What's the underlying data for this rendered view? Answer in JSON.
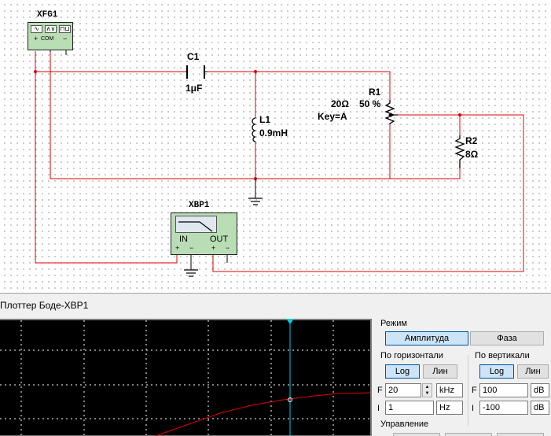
{
  "schematic": {
    "xfg": {
      "label": "XFG1",
      "com": "COM",
      "plus": "+",
      "minus": "−",
      "wave_sine": "∿",
      "wave_tri": "∧∨",
      "wave_square": "⊓⊔"
    },
    "c1": {
      "name": "C1",
      "value": "1μF"
    },
    "l1": {
      "name": "L1",
      "value": "0.9mH"
    },
    "r1": {
      "name": "R1",
      "value": "20Ω",
      "percent": "50 %",
      "key": "Key=A"
    },
    "r2": {
      "name": "R2",
      "value": "8Ω"
    },
    "xbp": {
      "label": "XBP1",
      "in": "IN",
      "out": "OUT",
      "plus": "+",
      "minus": "−"
    },
    "wire_color": "#e00000"
  },
  "bode": {
    "title": "Плоттер Боде-XBP1",
    "mode": {
      "label": "Режим",
      "amplitude": "Амплитуда",
      "phase": "Фаза",
      "selected": "Амплитуда"
    },
    "horizontal": {
      "label": "По горизонтали",
      "log": "Log",
      "lin": "Лин",
      "selected": "Log",
      "f_letter": "F",
      "f_value": "20",
      "f_unit": "kHz",
      "i_letter": "I",
      "i_value": "1",
      "i_unit": "Hz"
    },
    "vertical": {
      "label": "По вертикали",
      "log": "Log",
      "lin": "Лин",
      "selected": "Log",
      "f_letter": "F",
      "f_value": "100",
      "f_unit": "dB",
      "i_letter": "I",
      "i_value": "-100",
      "i_unit": "dB"
    },
    "control": {
      "label": "Управление"
    },
    "plot_colors": {
      "background": "#000000",
      "grid": "#ffffff",
      "trace": "#e00000",
      "cursor": "#00c8e0"
    }
  }
}
